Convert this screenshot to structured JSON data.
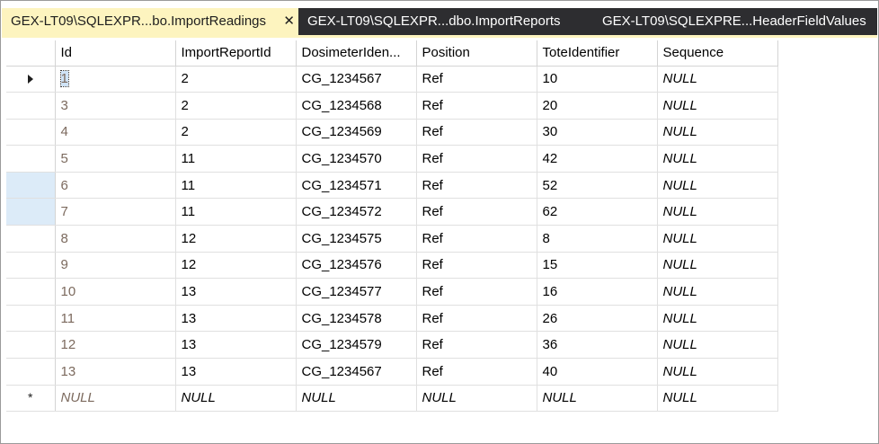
{
  "tabs": [
    {
      "label": "GEX-LT09\\SQLEXPR...bo.ImportReadings",
      "active": true,
      "close": "✕"
    },
    {
      "label": "GEX-LT09\\SQLEXPR...dbo.ImportReports",
      "active": false
    },
    {
      "label": "GEX-LT09\\SQLEXPRE...HeaderFieldValues",
      "active": false
    }
  ],
  "grid": {
    "columns": [
      "Id",
      "ImportReportId",
      "DosimeterIden...",
      "Position",
      "ToteIdentifier",
      "Sequence"
    ],
    "rows": [
      [
        "1",
        "2",
        "CG_1234567",
        "Ref",
        "10",
        "NULL"
      ],
      [
        "3",
        "2",
        "CG_1234568",
        "Ref",
        "20",
        "NULL"
      ],
      [
        "4",
        "2",
        "CG_1234569",
        "Ref",
        "30",
        "NULL"
      ],
      [
        "5",
        "11",
        "CG_1234570",
        "Ref",
        "42",
        "NULL"
      ],
      [
        "6",
        "11",
        "CG_1234571",
        "Ref",
        "52",
        "NULL"
      ],
      [
        "7",
        "11",
        "CG_1234572",
        "Ref",
        "62",
        "NULL"
      ],
      [
        "8",
        "12",
        "CG_1234575",
        "Ref",
        "8",
        "NULL"
      ],
      [
        "9",
        "12",
        "CG_1234576",
        "Ref",
        "15",
        "NULL"
      ],
      [
        "10",
        "13",
        "CG_1234577",
        "Ref",
        "16",
        "NULL"
      ],
      [
        "11",
        "13",
        "CG_1234578",
        "Ref",
        "26",
        "NULL"
      ],
      [
        "12",
        "13",
        "CG_1234579",
        "Ref",
        "36",
        "NULL"
      ],
      [
        "13",
        "13",
        "CG_1234567",
        "Ref",
        "40",
        "NULL"
      ]
    ],
    "new_row": [
      "NULL",
      "NULL",
      "NULL",
      "NULL",
      "NULL",
      "NULL"
    ],
    "new_row_marker": "*",
    "current_row_icon": "row-pointer-icon",
    "highlighted_selector_rows": [
      4,
      5
    ]
  },
  "colors": {
    "tab_strip": "#2d2d30",
    "active_tab": "#fdf4bf",
    "id_text": "#7c6a5e",
    "selector_highlight": "#dcebf8"
  }
}
